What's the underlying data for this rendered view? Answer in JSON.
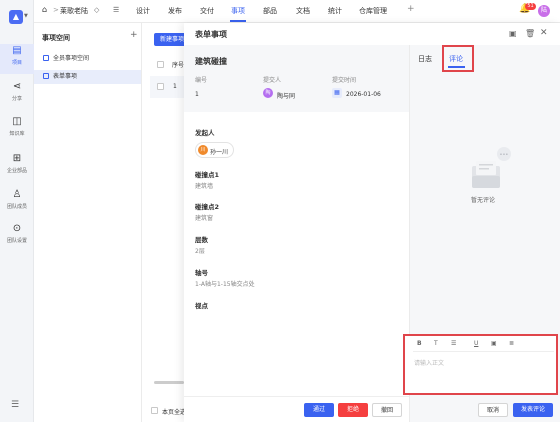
{
  "nav": {
    "breadcrumb_sep": ">",
    "project": "莱歌老陆",
    "tabs": [
      "设计",
      "发布",
      "交付",
      "事项",
      "部品",
      "文档",
      "统计",
      "仓库管理"
    ],
    "active_tab": "事项",
    "add": "+",
    "notif_count": "51",
    "avatar": "陆"
  },
  "rail": [
    {
      "label": "项目",
      "icon": "▤"
    },
    {
      "label": "分享",
      "icon": "⋖"
    },
    {
      "label": "知识库",
      "icon": "◫"
    },
    {
      "label": "企业部品",
      "icon": "⊞"
    },
    {
      "label": "团队成员",
      "icon": "♙"
    },
    {
      "label": "团队设置",
      "icon": "⊙"
    }
  ],
  "rail_bottom_icon": "☰",
  "sidebar": {
    "title": "事项空间",
    "add": "+",
    "items": [
      "全员事项空间",
      "表单事项"
    ]
  },
  "list": {
    "new_button": "新建事项",
    "col_no": "序号",
    "row_no": "1",
    "footer": "本页全选"
  },
  "dialog": {
    "title": "表单事项",
    "form_title": "建筑碰撞",
    "meta_labels": [
      "编号",
      "提交人",
      "提交时间"
    ],
    "number": "1",
    "submitter": "陶与同",
    "submitter_avatar": "陶",
    "submit_time": "2026-01-06",
    "initiator_label": "发起人",
    "initiator": "孙一川",
    "initiator_avatar": "川",
    "fields": [
      {
        "label": "碰撞点1",
        "value": "建筑墙"
      },
      {
        "label": "碰撞点2",
        "value": "建筑窗"
      },
      {
        "label": "层数",
        "value": "2层"
      },
      {
        "label": "轴号",
        "value": "1-A轴与1-15轴交点处"
      },
      {
        "label": "视点",
        "value": ""
      }
    ],
    "buttons": {
      "approve": "通过",
      "reject": "拒绝",
      "return": "撤回"
    }
  },
  "right": {
    "tabs": [
      "日志",
      "评论"
    ],
    "active_tab": "评论",
    "empty_text": "暂无评论",
    "editor_placeholder": "请输入正文",
    "toolbar": [
      "B",
      "T",
      "☰",
      "U",
      "▣",
      "≣"
    ],
    "cancel": "取消",
    "publish": "发表评论"
  },
  "colors": {
    "accent": "#3a62f0",
    "danger": "#f53f3f",
    "highlight": "#e0454b"
  }
}
